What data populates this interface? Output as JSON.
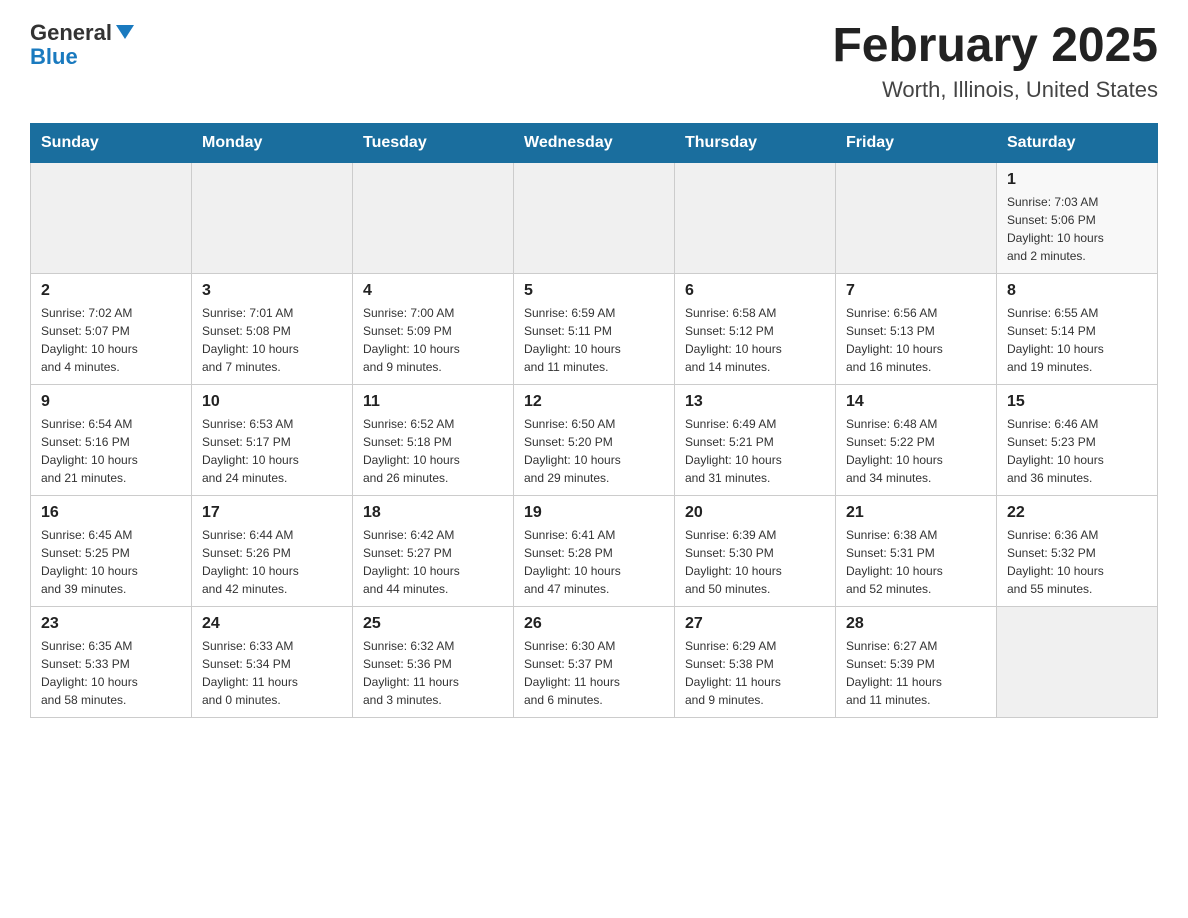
{
  "header": {
    "logo_general": "General",
    "logo_arrow": "▲",
    "logo_blue": "Blue",
    "title": "February 2025",
    "subtitle": "Worth, Illinois, United States"
  },
  "days_of_week": [
    "Sunday",
    "Monday",
    "Tuesday",
    "Wednesday",
    "Thursday",
    "Friday",
    "Saturday"
  ],
  "weeks": [
    [
      {
        "day": "",
        "info": ""
      },
      {
        "day": "",
        "info": ""
      },
      {
        "day": "",
        "info": ""
      },
      {
        "day": "",
        "info": ""
      },
      {
        "day": "",
        "info": ""
      },
      {
        "day": "",
        "info": ""
      },
      {
        "day": "1",
        "info": "Sunrise: 7:03 AM\nSunset: 5:06 PM\nDaylight: 10 hours\nand 2 minutes."
      }
    ],
    [
      {
        "day": "2",
        "info": "Sunrise: 7:02 AM\nSunset: 5:07 PM\nDaylight: 10 hours\nand 4 minutes."
      },
      {
        "day": "3",
        "info": "Sunrise: 7:01 AM\nSunset: 5:08 PM\nDaylight: 10 hours\nand 7 minutes."
      },
      {
        "day": "4",
        "info": "Sunrise: 7:00 AM\nSunset: 5:09 PM\nDaylight: 10 hours\nand 9 minutes."
      },
      {
        "day": "5",
        "info": "Sunrise: 6:59 AM\nSunset: 5:11 PM\nDaylight: 10 hours\nand 11 minutes."
      },
      {
        "day": "6",
        "info": "Sunrise: 6:58 AM\nSunset: 5:12 PM\nDaylight: 10 hours\nand 14 minutes."
      },
      {
        "day": "7",
        "info": "Sunrise: 6:56 AM\nSunset: 5:13 PM\nDaylight: 10 hours\nand 16 minutes."
      },
      {
        "day": "8",
        "info": "Sunrise: 6:55 AM\nSunset: 5:14 PM\nDaylight: 10 hours\nand 19 minutes."
      }
    ],
    [
      {
        "day": "9",
        "info": "Sunrise: 6:54 AM\nSunset: 5:16 PM\nDaylight: 10 hours\nand 21 minutes."
      },
      {
        "day": "10",
        "info": "Sunrise: 6:53 AM\nSunset: 5:17 PM\nDaylight: 10 hours\nand 24 minutes."
      },
      {
        "day": "11",
        "info": "Sunrise: 6:52 AM\nSunset: 5:18 PM\nDaylight: 10 hours\nand 26 minutes."
      },
      {
        "day": "12",
        "info": "Sunrise: 6:50 AM\nSunset: 5:20 PM\nDaylight: 10 hours\nand 29 minutes."
      },
      {
        "day": "13",
        "info": "Sunrise: 6:49 AM\nSunset: 5:21 PM\nDaylight: 10 hours\nand 31 minutes."
      },
      {
        "day": "14",
        "info": "Sunrise: 6:48 AM\nSunset: 5:22 PM\nDaylight: 10 hours\nand 34 minutes."
      },
      {
        "day": "15",
        "info": "Sunrise: 6:46 AM\nSunset: 5:23 PM\nDaylight: 10 hours\nand 36 minutes."
      }
    ],
    [
      {
        "day": "16",
        "info": "Sunrise: 6:45 AM\nSunset: 5:25 PM\nDaylight: 10 hours\nand 39 minutes."
      },
      {
        "day": "17",
        "info": "Sunrise: 6:44 AM\nSunset: 5:26 PM\nDaylight: 10 hours\nand 42 minutes."
      },
      {
        "day": "18",
        "info": "Sunrise: 6:42 AM\nSunset: 5:27 PM\nDaylight: 10 hours\nand 44 minutes."
      },
      {
        "day": "19",
        "info": "Sunrise: 6:41 AM\nSunset: 5:28 PM\nDaylight: 10 hours\nand 47 minutes."
      },
      {
        "day": "20",
        "info": "Sunrise: 6:39 AM\nSunset: 5:30 PM\nDaylight: 10 hours\nand 50 minutes."
      },
      {
        "day": "21",
        "info": "Sunrise: 6:38 AM\nSunset: 5:31 PM\nDaylight: 10 hours\nand 52 minutes."
      },
      {
        "day": "22",
        "info": "Sunrise: 6:36 AM\nSunset: 5:32 PM\nDaylight: 10 hours\nand 55 minutes."
      }
    ],
    [
      {
        "day": "23",
        "info": "Sunrise: 6:35 AM\nSunset: 5:33 PM\nDaylight: 10 hours\nand 58 minutes."
      },
      {
        "day": "24",
        "info": "Sunrise: 6:33 AM\nSunset: 5:34 PM\nDaylight: 11 hours\nand 0 minutes."
      },
      {
        "day": "25",
        "info": "Sunrise: 6:32 AM\nSunset: 5:36 PM\nDaylight: 11 hours\nand 3 minutes."
      },
      {
        "day": "26",
        "info": "Sunrise: 6:30 AM\nSunset: 5:37 PM\nDaylight: 11 hours\nand 6 minutes."
      },
      {
        "day": "27",
        "info": "Sunrise: 6:29 AM\nSunset: 5:38 PM\nDaylight: 11 hours\nand 9 minutes."
      },
      {
        "day": "28",
        "info": "Sunrise: 6:27 AM\nSunset: 5:39 PM\nDaylight: 11 hours\nand 11 minutes."
      },
      {
        "day": "",
        "info": ""
      }
    ]
  ]
}
